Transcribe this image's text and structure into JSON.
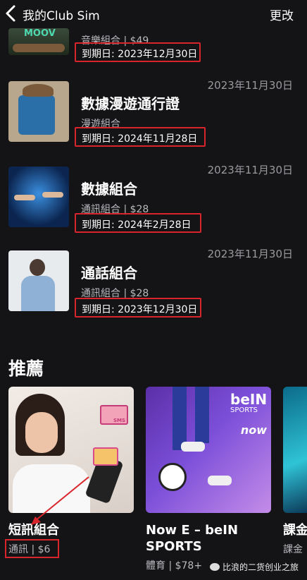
{
  "header": {
    "title": "我的Club Sim",
    "edit_label": "更改"
  },
  "products": [
    {
      "name": "",
      "sub": "音樂組合 | $49",
      "expiry": "到期日: 2023年12月30日",
      "date": "",
      "logo_text": "MOOV"
    },
    {
      "name": "數據漫遊通行證",
      "sub": "漫遊組合",
      "expiry": "到期日: 2024年11月28日",
      "date": "2023年11月30日"
    },
    {
      "name": "數據組合",
      "sub": "通訊組合 | $28",
      "expiry": "到期日: 2024年2月28日",
      "date": "2023年11月30日"
    },
    {
      "name": "通話組合",
      "sub": "通訊組合 | $28",
      "expiry": "到期日: 2023年12月30日",
      "date": "2023年11月30日"
    }
  ],
  "recommend": {
    "title": "推薦",
    "cards": [
      {
        "name": "短訊組合",
        "sub": "通訊 | $6",
        "sms_label": "SMS"
      },
      {
        "name_line1": "Now E – beIN",
        "name_line2": "SPORTS",
        "sub": "體育 | $78+",
        "logo_text": "beIN",
        "logo_sub": "SPORTS",
        "now_label": "now"
      },
      {
        "name": "課金",
        "sub": "課金"
      }
    ]
  },
  "watermark": "比浪的二货创业之旅",
  "colors": {
    "background": "#141416",
    "highlight": "#d8242b",
    "muted": "#9a9a9f"
  }
}
